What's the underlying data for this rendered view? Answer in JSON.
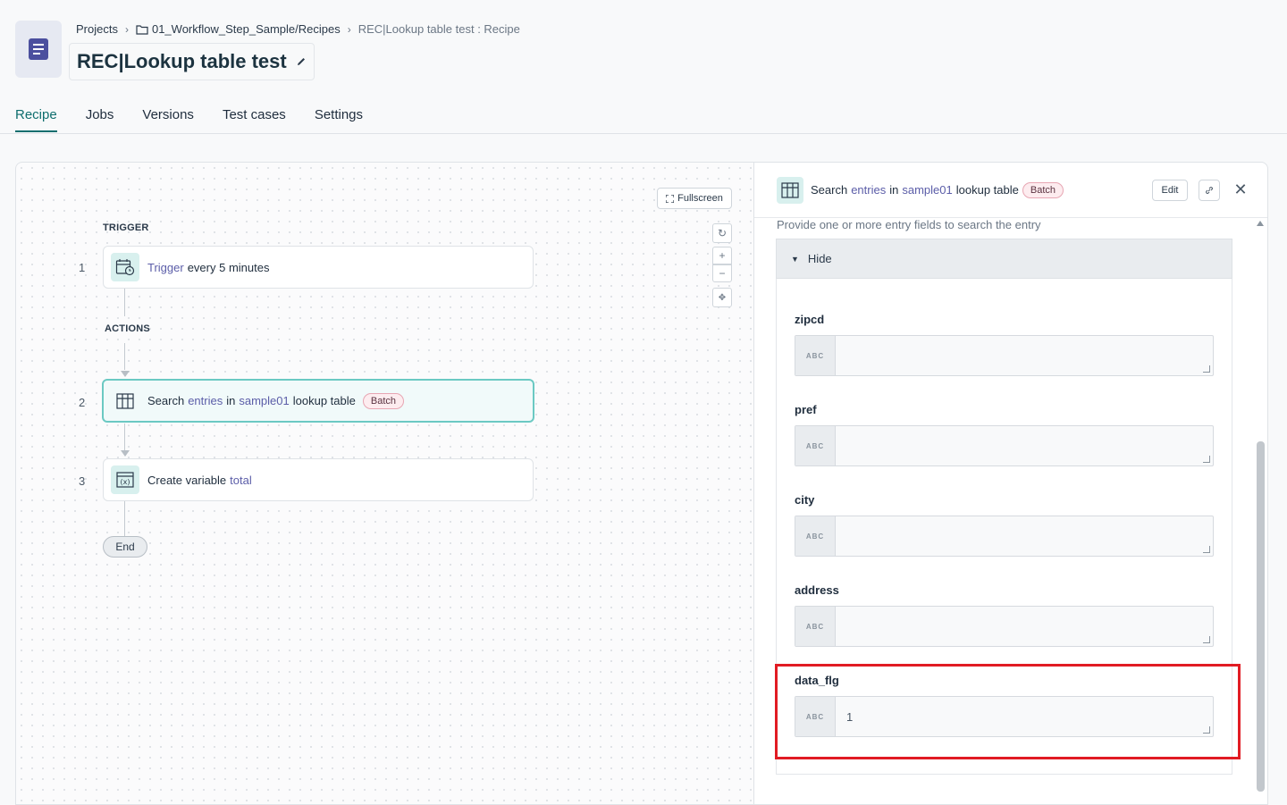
{
  "header": {
    "breadcrumb": {
      "projects": "Projects",
      "folder": "01_Workflow_Step_Sample/Recipes",
      "current": "REC|Lookup table test : Recipe"
    },
    "title": "REC|Lookup table test"
  },
  "tabs": [
    {
      "label": "Recipe",
      "active": true
    },
    {
      "label": "Jobs",
      "active": false
    },
    {
      "label": "Versions",
      "active": false
    },
    {
      "label": "Test cases",
      "active": false
    },
    {
      "label": "Settings",
      "active": false
    }
  ],
  "canvas": {
    "fullscreen_label": "Fullscreen",
    "trigger_label": "TRIGGER",
    "actions_label": "ACTIONS",
    "steps": [
      {
        "number": "1",
        "kw": "Trigger",
        "text": "every 5 minutes"
      },
      {
        "number": "2",
        "pre": "Search",
        "kw1": "entries",
        "mid": "in",
        "kw2": "sample01",
        "post": "lookup table",
        "badge": "Batch"
      },
      {
        "number": "3",
        "pre": "Create variable",
        "kw": "total"
      }
    ],
    "end_label": "End"
  },
  "panel": {
    "header": {
      "pre": "Search",
      "kw1": "entries",
      "mid": "in",
      "kw2": "sample01",
      "post": "lookup table",
      "badge": "Batch"
    },
    "edit_label": "Edit",
    "helper_text": "Provide one or more entry fields to search the entry",
    "group_toggle_label": "Hide",
    "fields": [
      {
        "label": "zipcd",
        "type": "ABC",
        "value": ""
      },
      {
        "label": "pref",
        "type": "ABC",
        "value": ""
      },
      {
        "label": "city",
        "type": "ABC",
        "value": ""
      },
      {
        "label": "address",
        "type": "ABC",
        "value": ""
      },
      {
        "label": "data_flg",
        "type": "ABC",
        "value": "1"
      }
    ]
  },
  "colors": {
    "accent": "#0f6e6e",
    "highlight": "#e11b23",
    "keyword": "#5b5da8"
  }
}
